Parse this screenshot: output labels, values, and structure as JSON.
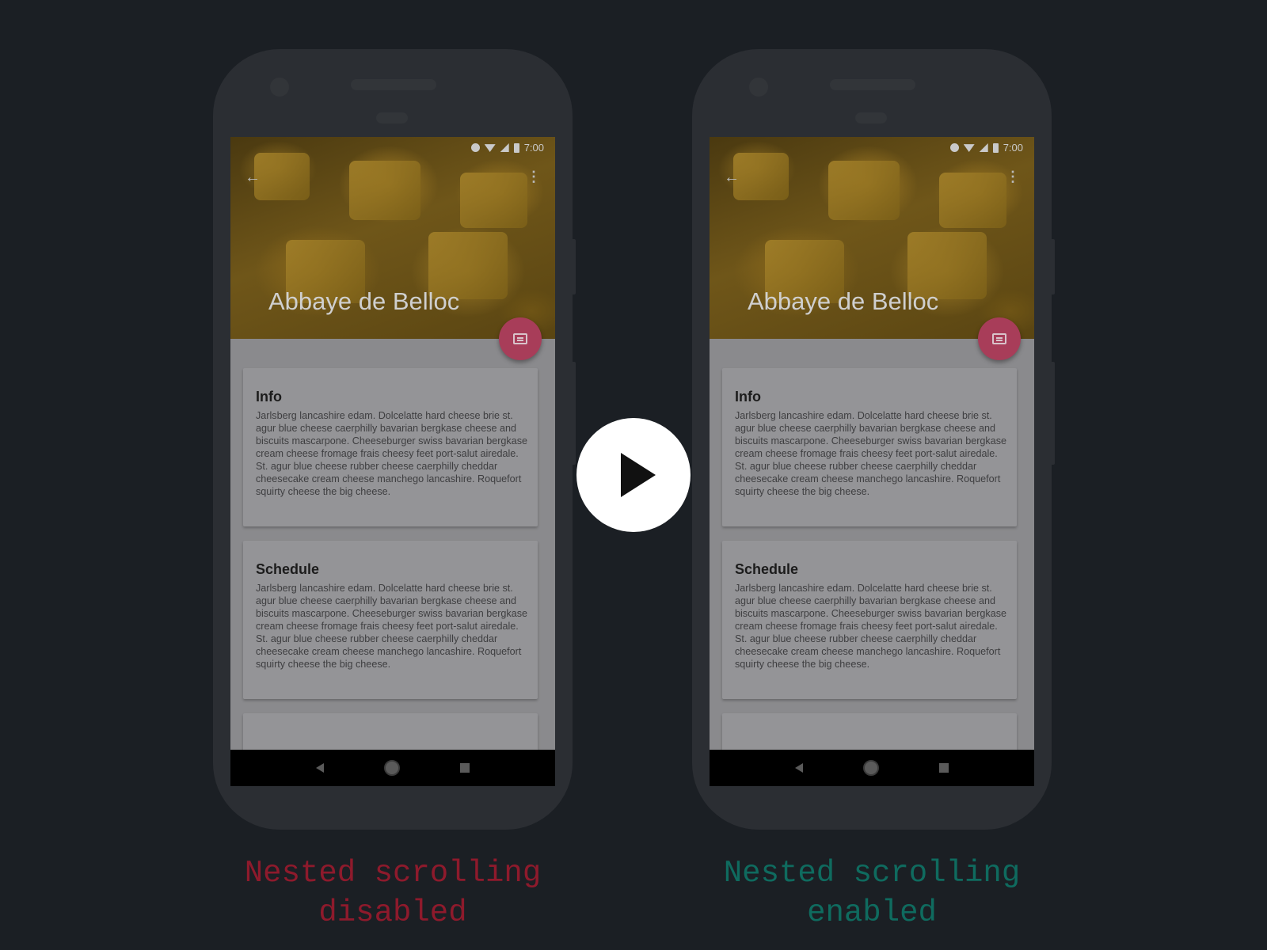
{
  "phones": [
    {
      "status_time": "7:00",
      "hero_title": "Abbaye de Belloc",
      "cards": [
        {
          "title": "Info",
          "body": "Jarlsberg lancashire edam. Dolcelatte hard cheese brie st. agur blue cheese caerphilly bavarian bergkase cheese and biscuits mascarpone. Cheeseburger swiss bavarian bergkase cream cheese fromage frais cheesy feet port-salut airedale. St. agur blue cheese rubber cheese caerphilly cheddar cheesecake cream cheese manchego lancashire. Roquefort squirty cheese the big cheese."
        },
        {
          "title": "Schedule",
          "body": "Jarlsberg lancashire edam. Dolcelatte hard cheese brie st. agur blue cheese caerphilly bavarian bergkase cheese and biscuits mascarpone. Cheeseburger swiss bavarian bergkase cream cheese fromage frais cheesy feet port-salut airedale. St. agur blue cheese rubber cheese caerphilly cheddar cheesecake cream cheese manchego lancashire. Roquefort squirty cheese the big cheese."
        }
      ],
      "caption": "Nested scrolling disabled"
    },
    {
      "status_time": "7:00",
      "hero_title": "Abbaye de Belloc",
      "cards": [
        {
          "title": "Info",
          "body": "Jarlsberg lancashire edam. Dolcelatte hard cheese brie st. agur blue cheese caerphilly bavarian bergkase cheese and biscuits mascarpone. Cheeseburger swiss bavarian bergkase cream cheese fromage frais cheesy feet port-salut airedale. St. agur blue cheese rubber cheese caerphilly cheddar cheesecake cream cheese manchego lancashire. Roquefort squirty cheese the big cheese."
        },
        {
          "title": "Schedule",
          "body": "Jarlsberg lancashire edam. Dolcelatte hard cheese brie st. agur blue cheese caerphilly bavarian bergkase cheese and biscuits mascarpone. Cheeseburger swiss bavarian bergkase cream cheese fromage frais cheesy feet port-salut airedale. St. agur blue cheese rubber cheese caerphilly cheddar cheesecake cream cheese manchego lancashire. Roquefort squirty cheese the big cheese."
        }
      ],
      "caption": "Nested scrolling enabled"
    }
  ],
  "icons": {
    "status": [
      "do-not-disturb-icon",
      "wifi-icon",
      "signal-icon",
      "battery-icon"
    ],
    "toolbar": [
      "back-arrow-icon",
      "overflow-menu-icon"
    ],
    "fab": "comment-icon",
    "nav": [
      "nav-back-icon",
      "nav-home-icon",
      "nav-recents-icon"
    ],
    "overlay": "play-icon"
  },
  "colors": {
    "background": "#1b1f24",
    "fab": "#a83d59",
    "caption_disabled": "#8e1a2c",
    "caption_enabled": "#0f6b5f",
    "play_button": "#ffffff"
  }
}
